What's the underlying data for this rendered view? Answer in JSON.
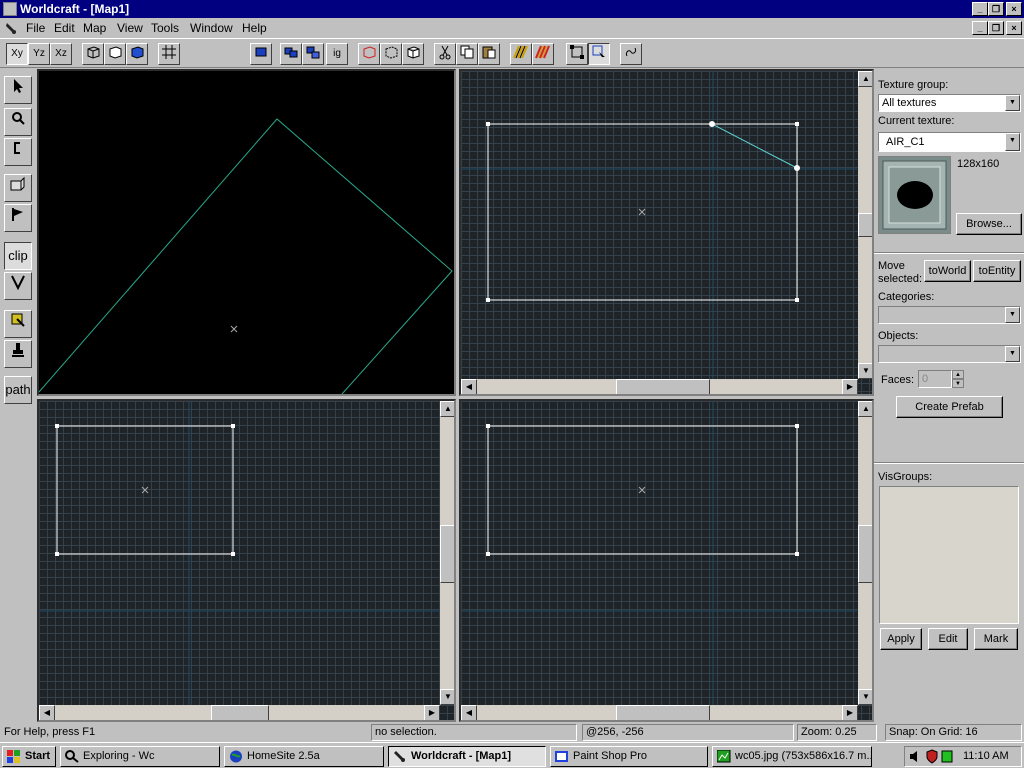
{
  "window": {
    "title": "Worldcraft - [Map1]"
  },
  "menu": [
    "File",
    "Edit",
    "Map",
    "View",
    "Tools",
    "Window",
    "Help"
  ],
  "toolbar": {
    "axis_xy": "Xy",
    "axis_yz": "Yz",
    "axis_xz": "Xz",
    "ignore_groups": "ig"
  },
  "left_tools": {
    "clip": "clip",
    "path": "path"
  },
  "panel": {
    "texture_group_label": "Texture group:",
    "texture_group_value": "All textures",
    "current_texture_label": "Current texture:",
    "current_texture_value": "AIR_C1",
    "texture_size": "128x160",
    "browse": "Browse...",
    "move_selected_label_1": "Move",
    "move_selected_label_2": "selected:",
    "to_world": "toWorld",
    "to_entity": "toEntity",
    "categories_label": "Categories:",
    "objects_label": "Objects:",
    "faces_label": "Faces:",
    "faces_value": "0",
    "create_prefab": "Create Prefab",
    "visgroups_label": "VisGroups:",
    "apply": "Apply",
    "edit": "Edit",
    "mark": "Mark"
  },
  "status": {
    "help": "For Help, press F1",
    "selection": "no selection.",
    "coords": "@256, -256",
    "zoom": "Zoom: 0.25",
    "snap": "Snap: On Grid: 16"
  },
  "taskbar": {
    "start": "Start",
    "tasks": [
      "Exploring - Wc",
      "HomeSite 2.5a",
      "Worldcraft - [Map1]",
      "Paint Shop Pro",
      "wc05.jpg (753x586x16.7 m..."
    ],
    "clock": "11:10 AM"
  },
  "colors": {
    "title_bar": "#000080",
    "face": "#c0c0c0",
    "grid_bg": "#1e2428",
    "grid_line": "#35414a",
    "brush": "#ffffff",
    "clip_line": "#5fd3d3",
    "wire": "#2aa88a"
  }
}
